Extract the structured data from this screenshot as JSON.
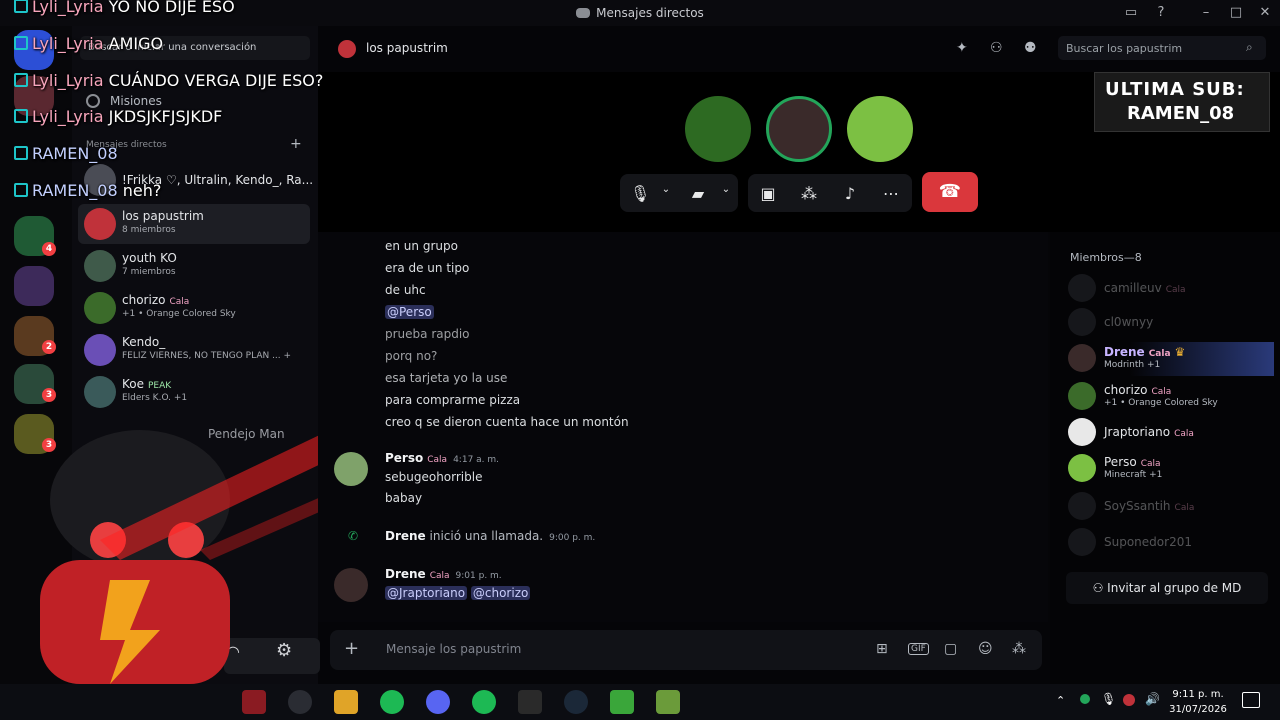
{
  "window": {
    "title": "Mensajes directos"
  },
  "overlay_chat": [
    {
      "user": "Lyli_Lyria",
      "text": "YO NO DIJE ESO"
    },
    {
      "user": "Lyli_Lyria",
      "text": "AMIGO"
    },
    {
      "user": "Lyli_Lyria",
      "text": "CUÁNDO VERGA DIJE ESO?"
    },
    {
      "user": "Lyli_Lyria",
      "text": "JKDSJKFJSJKDF"
    },
    {
      "user": "RAMEN_08",
      "text": ""
    },
    {
      "user": "RAMEN_08",
      "text": "neh?"
    }
  ],
  "dm_sidebar": {
    "search_placeholder": "Buscar o iniciar una conversación",
    "missions": "Misiones",
    "section": "Mensajes directos",
    "items": [
      {
        "name": "!Frikka ♡, Ultralin, Kendo_, Ra...",
        "sub": ""
      },
      {
        "name": "los papustrim",
        "sub": "8 miembros"
      },
      {
        "name": "youth KO",
        "sub": "7 miembros"
      },
      {
        "name": "chorizo",
        "tag": "Cala",
        "sub": "+1 • Orange Colored Sky"
      },
      {
        "name": "Kendo_",
        "sub": "FELIZ VIERNES, NO TENGO PLAN ... +"
      },
      {
        "name": "Koe",
        "tag": "PEAK",
        "sub": "Elders K.O. +1"
      },
      {
        "name": "Pendejo Man",
        "sub": ""
      }
    ]
  },
  "channel": {
    "name": "los papustrim",
    "search_placeholder": "Buscar los papustrim"
  },
  "sub_box": {
    "line1": "ULTIMA SUB:",
    "line2": "RAMEN_08"
  },
  "messages": {
    "lines": [
      "en un grupo",
      "era de un tipo",
      "de uhc",
      "@Perso",
      "prueba rapdio",
      "porq no?",
      "esa tarjeta yo la use",
      "para comprarme pizza",
      "creo q se dieron cuenta hace un montón"
    ],
    "perso": {
      "author": "Perso",
      "tag": "Cala",
      "time": "4:17 a. m.",
      "lines": [
        "sebugeohorrible",
        "babay"
      ]
    },
    "call": {
      "author": "Drene",
      "text": "inició una llamada.",
      "time": "9:00 p. m."
    },
    "drene": {
      "author": "Drene",
      "tag": "Cala",
      "time": "9:01 p. m.",
      "mention1": "@Jraptoriano",
      "mention2": "@chorizo"
    }
  },
  "composer": {
    "placeholder": "Mensaje los papustrim"
  },
  "members": {
    "header": "Miembros—8",
    "list": [
      {
        "name": "camilleuv",
        "tag": "Cala",
        "sub": "",
        "dim": true
      },
      {
        "name": "cl0wnyy",
        "tag": "",
        "sub": "",
        "dim": true
      },
      {
        "name": "Drene",
        "tag": "Cala",
        "sub": "Modrinth +1",
        "dim": false
      },
      {
        "name": "chorizo",
        "tag": "Cala",
        "sub": "+1 • Orange Colored Sky",
        "dim": false
      },
      {
        "name": "Jraptoriano",
        "tag": "Cala",
        "sub": "",
        "dim": false
      },
      {
        "name": "Perso",
        "tag": "Cala",
        "sub": "Minecraft +1",
        "dim": false
      },
      {
        "name": "SoySsantih",
        "tag": "Cala",
        "sub": "",
        "dim": true
      },
      {
        "name": "Suponedor201",
        "tag": "",
        "sub": "",
        "dim": true
      }
    ],
    "invite": "Invitar al grupo de MD"
  },
  "rail_badges": [
    "4",
    "2",
    "3",
    "3"
  ],
  "taskbar": {
    "time": "9:11 p. m.",
    "date": "31/07/2026"
  }
}
